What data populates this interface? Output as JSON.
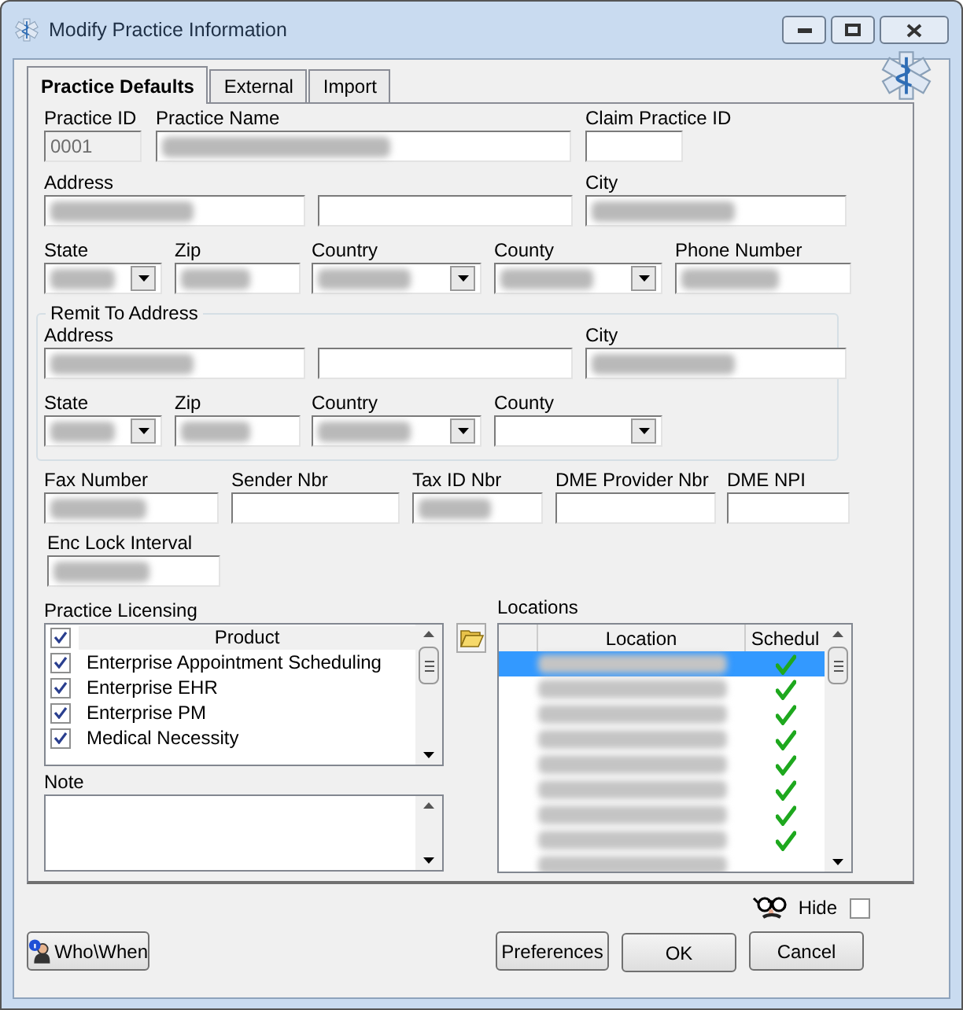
{
  "window": {
    "title": "Modify Practice Information"
  },
  "tabs": [
    {
      "label": "Practice Defaults",
      "selected": true
    },
    {
      "label": "External",
      "selected": false
    },
    {
      "label": "Import",
      "selected": false
    }
  ],
  "rows": [
    [
      {
        "label": "Practice ID",
        "kind": "text",
        "value": "0001",
        "disabled": true
      },
      {
        "label": "Practice Name",
        "kind": "text",
        "blurred": true
      },
      {
        "label": "Claim Practice ID",
        "kind": "text"
      }
    ],
    [
      {
        "label": "Address",
        "kind": "text",
        "blurred": true
      },
      {
        "kind": "text"
      },
      {
        "label": "City",
        "kind": "text",
        "blurred": true
      }
    ],
    [
      {
        "label": "State",
        "kind": "combo",
        "blurred": true
      },
      {
        "label": "Zip",
        "kind": "text",
        "blurred": true
      },
      {
        "label": "Country",
        "kind": "combo",
        "blurred": true
      },
      {
        "label": "County",
        "kind": "combo",
        "blurred": true
      },
      {
        "label": "Phone Number",
        "kind": "text",
        "blurred": true
      }
    ]
  ],
  "remit": {
    "title": "Remit To Address",
    "rows": [
      [
        {
          "label": "Address",
          "kind": "text",
          "blurred": true
        },
        {
          "kind": "text"
        },
        {
          "label": "City",
          "kind": "text",
          "blurred": true
        }
      ],
      [
        {
          "label": "State",
          "kind": "combo",
          "blurred": true
        },
        {
          "label": "Zip",
          "kind": "text",
          "blurred": true
        },
        {
          "label": "Country",
          "kind": "combo",
          "blurred": true
        },
        {
          "label": "County",
          "kind": "combo"
        }
      ]
    ]
  },
  "ids": [
    {
      "label": "Fax Number",
      "kind": "text",
      "blurred": true
    },
    {
      "label": "Sender Nbr",
      "kind": "text"
    },
    {
      "label": "Tax ID Nbr",
      "kind": "text",
      "blurred": true
    },
    {
      "label": "DME Provider Nbr",
      "kind": "text"
    },
    {
      "label": "DME NPI",
      "kind": "text"
    }
  ],
  "enc_lock": {
    "label": "Enc Lock Interval",
    "kind": "text",
    "blurred": true
  },
  "licensing": {
    "label": "Practice Licensing",
    "header": "Product",
    "all_checked": true,
    "rows": [
      {
        "name": "Enterprise Appointment Scheduling",
        "checked": true
      },
      {
        "name": "Enterprise EHR",
        "checked": true
      },
      {
        "name": "Enterprise PM",
        "checked": true
      },
      {
        "name": "Medical Necessity",
        "checked": true
      }
    ]
  },
  "note": {
    "label": "Note"
  },
  "locations": {
    "label": "Locations",
    "columns": [
      "Location",
      "Schedul"
    ],
    "rows": [
      {
        "selected": true,
        "scheduled": true
      },
      {
        "selected": false,
        "scheduled": true
      },
      {
        "selected": false,
        "scheduled": true
      },
      {
        "selected": false,
        "scheduled": true
      },
      {
        "selected": false,
        "scheduled": true
      },
      {
        "selected": false,
        "scheduled": true
      },
      {
        "selected": false,
        "scheduled": true
      },
      {
        "selected": false,
        "scheduled": true
      },
      {
        "selected": false,
        "scheduled": false
      }
    ]
  },
  "hide": {
    "label": "Hide",
    "checked": false
  },
  "buttons": {
    "who_when": "Who\\When",
    "preferences": "Preferences",
    "ok": "OK",
    "cancel": "Cancel"
  }
}
